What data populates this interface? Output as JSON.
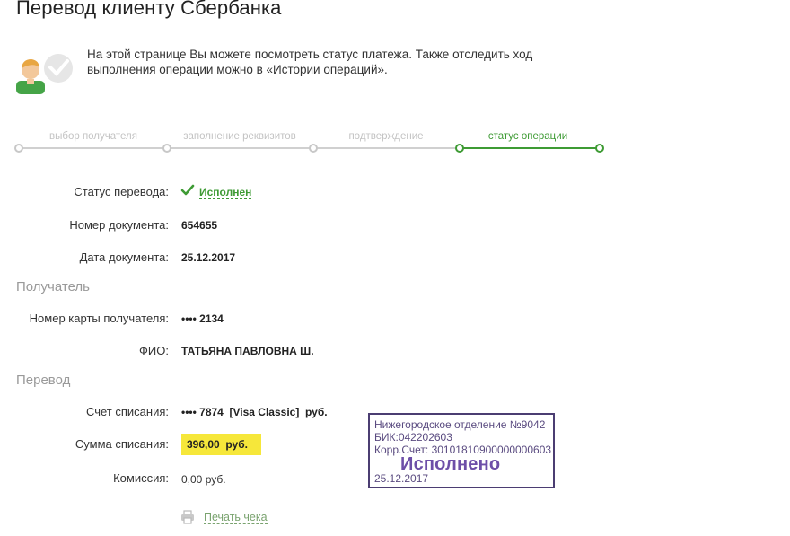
{
  "page": {
    "title": "Перевод клиенту Сбербанка"
  },
  "intro": {
    "line1": "На этой странице Вы можете посмотреть статус платежа. Также отследить ход",
    "line2": "выполнения операции можно в «Истории операций»."
  },
  "stepper": {
    "steps": [
      {
        "label": "выбор получателя",
        "state": "done"
      },
      {
        "label": "заполнение реквизитов",
        "state": "done"
      },
      {
        "label": "подтверждение",
        "state": "done"
      },
      {
        "label": "статус операции",
        "state": "active"
      }
    ]
  },
  "details": {
    "status_label": "Статус перевода:",
    "status_value": "Исполнен",
    "doc_number_label": "Номер документа:",
    "doc_number_value": "654655",
    "doc_date_label": "Дата документа:",
    "doc_date_value": "25.12.2017"
  },
  "recipient": {
    "section_title": "Получатель",
    "card_label": "Номер карты получателя:",
    "card_value": "•••• 2134",
    "name_label": "ФИО:",
    "name_value": "ТАТЬЯНА ПАВЛОВНА Ш."
  },
  "transfer": {
    "section_title": "Перевод",
    "account_label": "Счет списания:",
    "account_value": "•••• 7874  [Visa Classic]  руб.",
    "amount_label": "Сумма списания:",
    "amount_value": "396,00  руб.",
    "commission_label": "Комиссия:",
    "commission_value": "0,00 руб."
  },
  "actions": {
    "print_label": "Печать чека"
  },
  "stamp": {
    "line1": "Нижегородское отделение №9042",
    "line2": "БИК:042202603",
    "line3": "Корр.Счет: 30101810900000000603",
    "status": "Исполнено",
    "date": "25.12.2017"
  },
  "colors": {
    "accent_green": "#3e9b34",
    "highlight_yellow": "#f6e73a",
    "stamp_purple": "#4b3d72",
    "muted_gray": "#9a9a9a"
  }
}
